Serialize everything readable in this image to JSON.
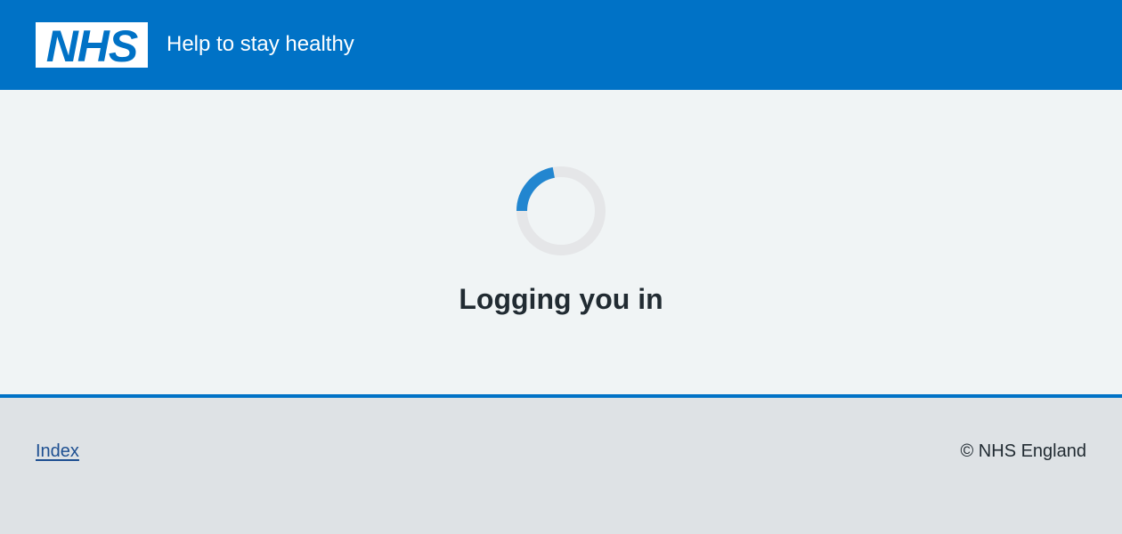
{
  "header": {
    "logo_text": "NHS",
    "service_name": "Help to stay healthy",
    "brand_color": "#0072c6"
  },
  "main": {
    "status_text": "Logging you in",
    "spinner": {
      "track_color": "#e5e6e8",
      "indicator_color": "#2286d0"
    }
  },
  "footer": {
    "links": [
      {
        "label": "Index"
      }
    ],
    "copyright": "© NHS England"
  }
}
